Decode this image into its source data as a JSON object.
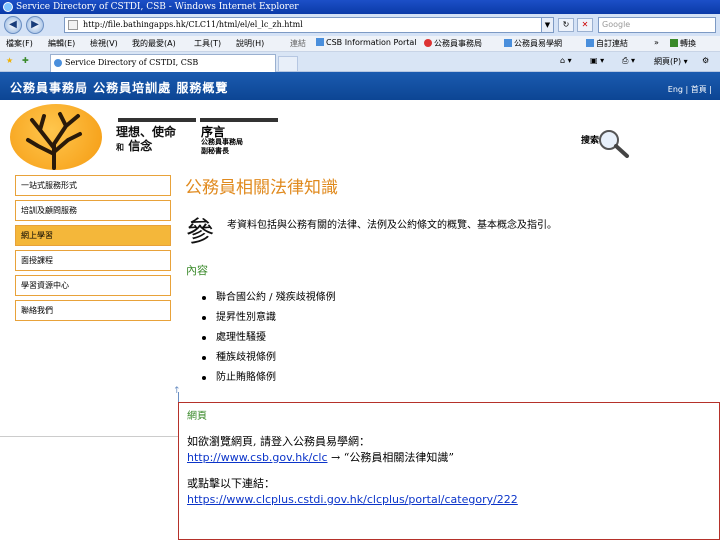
{
  "window": {
    "title": "Service Directory of CSTDI, CSB - Windows Internet Explorer"
  },
  "address_bar": {
    "url": "http://file.bathingapps.hk/CLC11/html/el/el_lc_zh.html",
    "search_placeholder": "Google"
  },
  "menu": {
    "items": [
      "檔案(F)",
      "編輯(E)",
      "檢視(V)",
      "我的最愛(A)",
      "工具(T)",
      "說明(H)"
    ],
    "links_label": "連結",
    "links": [
      "CSB Information Portal",
      "公務員事務局",
      "公務員易學網",
      "自訂連結"
    ],
    "translate": "轉換"
  },
  "tabs": {
    "active_label": "Service Directory of CSTDI, CSB",
    "page_menu": "網頁(P)"
  },
  "site": {
    "title": "公務員事務局 公務員培訓處 服務概覽",
    "lang_links": "Eng | 首頁 |"
  },
  "banner": {
    "vision_line1": "理想、使命",
    "vision_line2_prefix": "和",
    "vision_line2": "信念",
    "preface": "序言",
    "preface_sub1": "公務員事務局",
    "preface_sub2": "副秘書長",
    "search_label": "搜索"
  },
  "sidebar": {
    "items": [
      {
        "label": "一站式服務形式",
        "active": false
      },
      {
        "label": "培訓及顧問服務",
        "active": false
      },
      {
        "label": "網上學習",
        "active": true
      },
      {
        "label": "面授課程",
        "active": false
      },
      {
        "label": "學習資源中心",
        "active": false
      },
      {
        "label": "聯絡我們",
        "active": false
      }
    ]
  },
  "main": {
    "title": "公務員相關法律知識",
    "intro_first_char": "參",
    "intro_rest": "考資料包括與公務有關的法律、法例及公約條文的概覽、基本概念及指引。",
    "content_label": "內容",
    "bullets": [
      "聯合國公約 / 殘疾歧視條例",
      "提昇性別意識",
      "處理性騷擾",
      "種族歧視條例",
      "防止賄賂條例"
    ]
  },
  "callout": {
    "heading": "網頁",
    "line1": "如欲瀏覽網頁, 請登入公務員易學網：",
    "link1": "http://www.csb.gov.hk/clc",
    "arrow_text": " → “公務員相關法律知識”",
    "line2": "或點擊以下連結：",
    "link2": "https://www.clcplus.cstdi.gov.hk/clcplus/portal/category/222"
  },
  "colors": {
    "header_blue": "#1b5bb0",
    "accent_orange": "#e08a1e",
    "active_item": "#f4b73a",
    "content_green": "#3a8a2a",
    "callout_border": "#b5312a",
    "link_blue": "#0b34c9"
  }
}
